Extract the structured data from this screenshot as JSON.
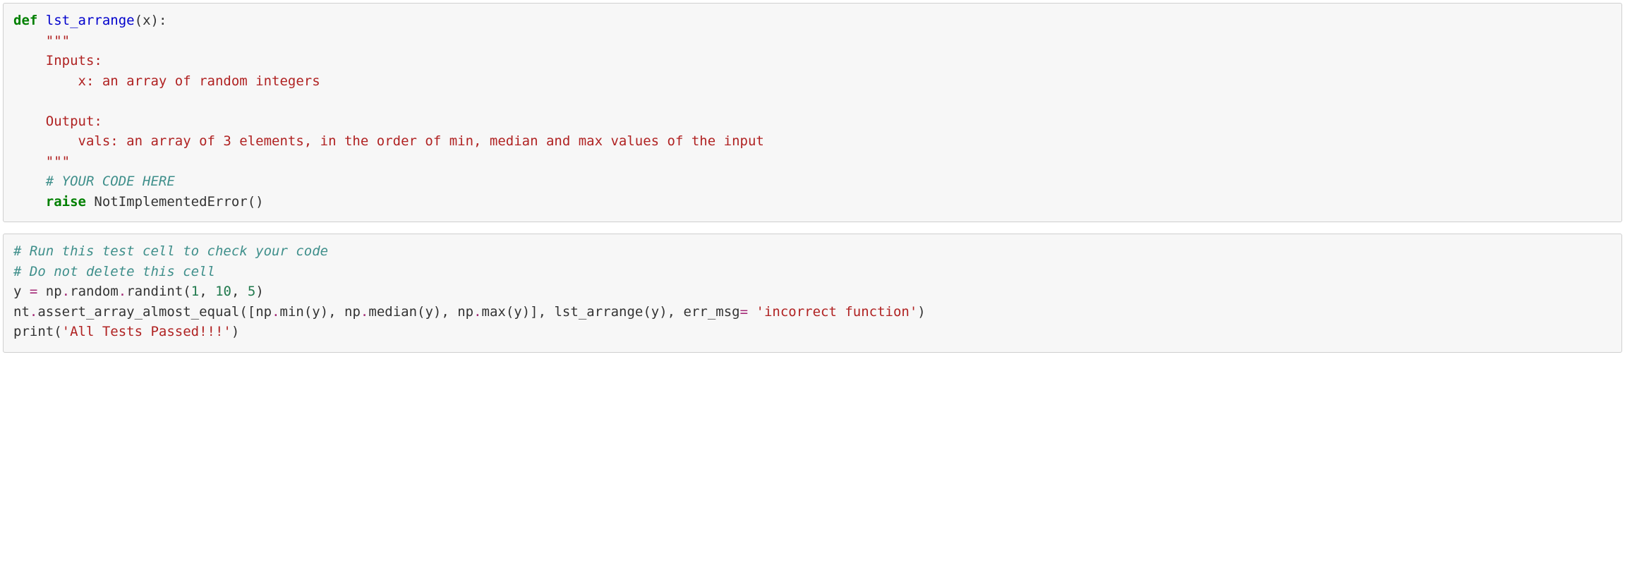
{
  "cell1": {
    "l1_def": "def",
    "l1_func": "lst_arrange",
    "l1_rest": "(x):",
    "l2": "    \"\"\"",
    "l3": "    Inputs:",
    "l4": "        x: an array of random integers",
    "l5": "",
    "l6": "    Output:",
    "l7": "        vals: an array of 3 elements, in the order of min, median and max values of the input",
    "l8": "    \"\"\"",
    "l9": "    # YOUR CODE HERE",
    "l10_indent": "    ",
    "l10_raise": "raise",
    "l10_rest": " NotImplementedError()"
  },
  "cell2": {
    "l1": "# Run this test cell to check your code",
    "l2": "# Do not delete this cell",
    "l3_a": "y ",
    "l3_eq": "=",
    "l3_b": " np",
    "l3_dot1": ".",
    "l3_c": "random",
    "l3_dot2": ".",
    "l3_d": "randint(",
    "l3_n1": "1",
    "l3_comma1": ", ",
    "l3_n2": "10",
    "l3_comma2": ", ",
    "l3_n3": "5",
    "l3_close": ")",
    "l4_a": "nt",
    "l4_dot1": ".",
    "l4_b": "assert_array_almost_equal([np",
    "l4_dot2": ".",
    "l4_c": "min(y), np",
    "l4_dot3": ".",
    "l4_d": "median(y), np",
    "l4_dot4": ".",
    "l4_e": "max(y)], lst_arrange(y), err_msg",
    "l4_eq": "=",
    "l4_sp": " ",
    "l4_str": "'incorrect function'",
    "l4_close": ")",
    "l5_a": "print(",
    "l5_str": "'All Tests Passed!!!'",
    "l5_close": ")"
  }
}
